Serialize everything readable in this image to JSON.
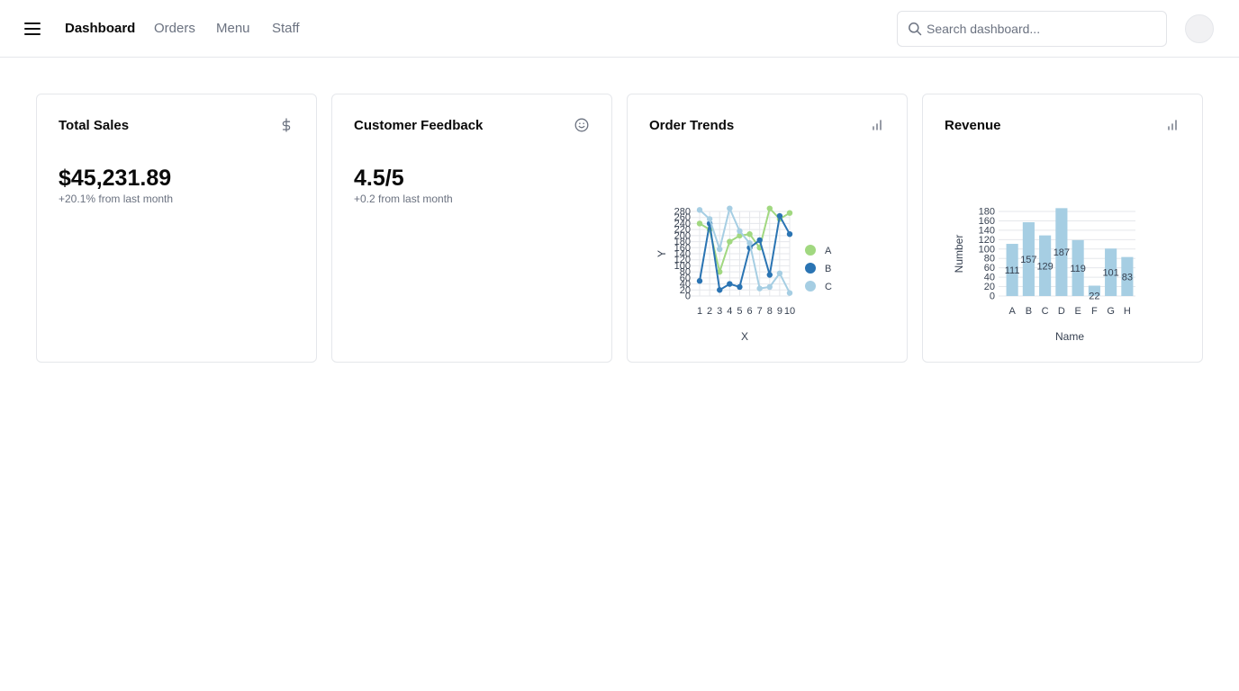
{
  "header": {
    "nav": [
      {
        "label": "Dashboard",
        "active": true
      },
      {
        "label": "Orders",
        "active": false
      },
      {
        "label": "Menu",
        "active": false
      },
      {
        "label": "Staff",
        "active": false
      }
    ],
    "search": {
      "placeholder": "Search dashboard..."
    }
  },
  "cards": [
    {
      "title": "Total Sales",
      "icon": "dollar-icon",
      "value": "$45,231.89",
      "delta": "+20.1% from last month"
    },
    {
      "title": "Customer Feedback",
      "icon": "smile-icon",
      "value": "4.5/5",
      "delta": "+0.2 from last month"
    },
    {
      "title": "Order Trends",
      "icon": "bar-chart-icon"
    },
    {
      "title": "Revenue",
      "icon": "bar-chart-icon"
    }
  ],
  "colors": {
    "A": "#a1d880",
    "B": "#2a74b3",
    "C": "#a6cee3",
    "bar": "#a6cee3",
    "muted": "#6b7280"
  },
  "chart_data": [
    {
      "type": "line",
      "xlabel": "X",
      "ylabel": "Y",
      "x": [
        1,
        2,
        3,
        4,
        5,
        6,
        7,
        8,
        9,
        10
      ],
      "ylim": [
        0,
        280
      ],
      "yticks": [
        0,
        20,
        40,
        60,
        80,
        100,
        120,
        140,
        160,
        180,
        200,
        220,
        240,
        260,
        280
      ],
      "legend": "right",
      "grid": true,
      "series": [
        {
          "name": "A",
          "color": "#a1d880",
          "values": [
            240,
            220,
            80,
            180,
            200,
            205,
            160,
            290,
            255,
            275
          ]
        },
        {
          "name": "B",
          "color": "#2a74b3",
          "values": [
            50,
            240,
            20,
            40,
            30,
            160,
            185,
            70,
            265,
            205
          ]
        },
        {
          "name": "C",
          "color": "#a6cee3",
          "values": [
            285,
            255,
            155,
            295,
            215,
            175,
            25,
            30,
            75,
            10
          ]
        }
      ]
    },
    {
      "type": "bar",
      "xlabel": "Name",
      "ylabel": "Number",
      "categories": [
        "A",
        "B",
        "C",
        "D",
        "E",
        "F",
        "G",
        "H"
      ],
      "values": [
        111,
        157,
        129,
        187,
        119,
        22,
        101,
        83
      ],
      "ylim": [
        0,
        180
      ],
      "yticks": [
        0,
        20,
        40,
        60,
        80,
        100,
        120,
        140,
        160,
        180
      ],
      "grid": true,
      "data_labels": true
    }
  ]
}
